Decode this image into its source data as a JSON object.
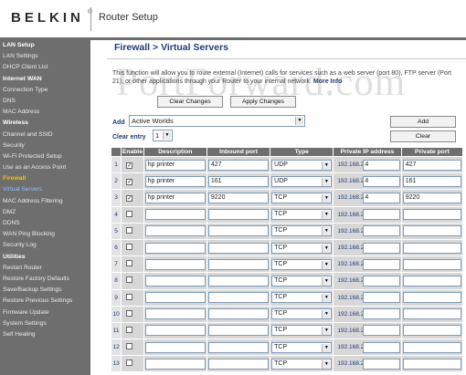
{
  "header": {
    "brand": "BELKIN",
    "brand_mark": "®",
    "app_title": "Router Setup"
  },
  "sidebar": {
    "items": [
      {
        "label": "LAN Setup",
        "kind": "heading"
      },
      {
        "label": "LAN Settings",
        "kind": "link"
      },
      {
        "label": "DHCP Client List",
        "kind": "link"
      },
      {
        "label": "Internet WAN",
        "kind": "heading"
      },
      {
        "label": "Connection Type",
        "kind": "link"
      },
      {
        "label": "DNS",
        "kind": "link"
      },
      {
        "label": "MAC Address",
        "kind": "link"
      },
      {
        "label": "Wireless",
        "kind": "heading"
      },
      {
        "label": "Channel and SSID",
        "kind": "link"
      },
      {
        "label": "Security",
        "kind": "link"
      },
      {
        "label": "Wi-Fi Protected Setup",
        "kind": "link"
      },
      {
        "label": "Use as an Access Point",
        "kind": "link"
      },
      {
        "label": "Firewall",
        "kind": "heading-active"
      },
      {
        "label": "Virtual Servers",
        "kind": "current"
      },
      {
        "label": "MAC Address Filtering",
        "kind": "link"
      },
      {
        "label": "DMZ",
        "kind": "link"
      },
      {
        "label": "DDNS",
        "kind": "link"
      },
      {
        "label": "WAN Ping Blocking",
        "kind": "link"
      },
      {
        "label": "Security Log",
        "kind": "link"
      },
      {
        "label": "Utilities",
        "kind": "heading"
      },
      {
        "label": "Restart Router",
        "kind": "link"
      },
      {
        "label": "Restore Factory Defaults",
        "kind": "link"
      },
      {
        "label": "Save/Backup Settings",
        "kind": "link"
      },
      {
        "label": "Restore Previous Settings",
        "kind": "link"
      },
      {
        "label": "Firmware Update",
        "kind": "link"
      },
      {
        "label": "System Settings",
        "kind": "link"
      },
      {
        "label": "Self Healing",
        "kind": "link"
      }
    ]
  },
  "main": {
    "title": "Firewall > Virtual Servers",
    "description": "This function will allow you to route external (Internet) calls for services such as a web server (port 80), FTP server (Port 21), or other applications through your Router to your internal network.",
    "more_info": "More Info",
    "watermark": "PortForward.com",
    "clear_changes_label": "Clear Changes",
    "apply_changes_label": "Apply Changes",
    "add_label": "Add",
    "add_select_value": "Active Worlds",
    "add_button_label": "Add",
    "clear_entry_label": "Clear entry",
    "clear_entry_value": "1",
    "clear_button_label": "Clear"
  },
  "table": {
    "headers": [
      "Enable",
      "Description",
      "Inbound port",
      "Type",
      "Private IP address",
      "Private port"
    ],
    "ip_prefix": "192.168.2.",
    "rows": [
      {
        "num": "1",
        "enabled": true,
        "description": "hp printer",
        "inbound": "427",
        "type": "UDP",
        "ip_last": "4",
        "private_port": "427"
      },
      {
        "num": "2",
        "enabled": true,
        "description": "hp printer",
        "inbound": "161",
        "type": "UDP",
        "ip_last": "4",
        "private_port": "161"
      },
      {
        "num": "3",
        "enabled": true,
        "description": "hp printer",
        "inbound": "9220",
        "type": "TCP",
        "ip_last": "4",
        "private_port": "9220"
      },
      {
        "num": "4",
        "enabled": false,
        "description": "",
        "inbound": "",
        "type": "TCP",
        "ip_last": "",
        "private_port": ""
      },
      {
        "num": "5",
        "enabled": false,
        "description": "",
        "inbound": "",
        "type": "TCP",
        "ip_last": "",
        "private_port": ""
      },
      {
        "num": "6",
        "enabled": false,
        "description": "",
        "inbound": "",
        "type": "TCP",
        "ip_last": "",
        "private_port": ""
      },
      {
        "num": "7",
        "enabled": false,
        "description": "",
        "inbound": "",
        "type": "TCP",
        "ip_last": "",
        "private_port": ""
      },
      {
        "num": "8",
        "enabled": false,
        "description": "",
        "inbound": "",
        "type": "TCP",
        "ip_last": "",
        "private_port": ""
      },
      {
        "num": "9",
        "enabled": false,
        "description": "",
        "inbound": "",
        "type": "TCP",
        "ip_last": "",
        "private_port": ""
      },
      {
        "num": "10",
        "enabled": false,
        "description": "",
        "inbound": "",
        "type": "TCP",
        "ip_last": "",
        "private_port": ""
      },
      {
        "num": "11",
        "enabled": false,
        "description": "",
        "inbound": "",
        "type": "TCP",
        "ip_last": "",
        "private_port": ""
      },
      {
        "num": "12",
        "enabled": false,
        "description": "",
        "inbound": "",
        "type": "TCP",
        "ip_last": "",
        "private_port": ""
      },
      {
        "num": "13",
        "enabled": false,
        "description": "",
        "inbound": "",
        "type": "TCP",
        "ip_last": "",
        "private_port": ""
      }
    ]
  },
  "colors": {
    "sidebar_bg": "#6e6e6e",
    "title_blue": "#1f3c7b",
    "active_heading": "#ffc000",
    "current_link": "#8cc2ff"
  }
}
